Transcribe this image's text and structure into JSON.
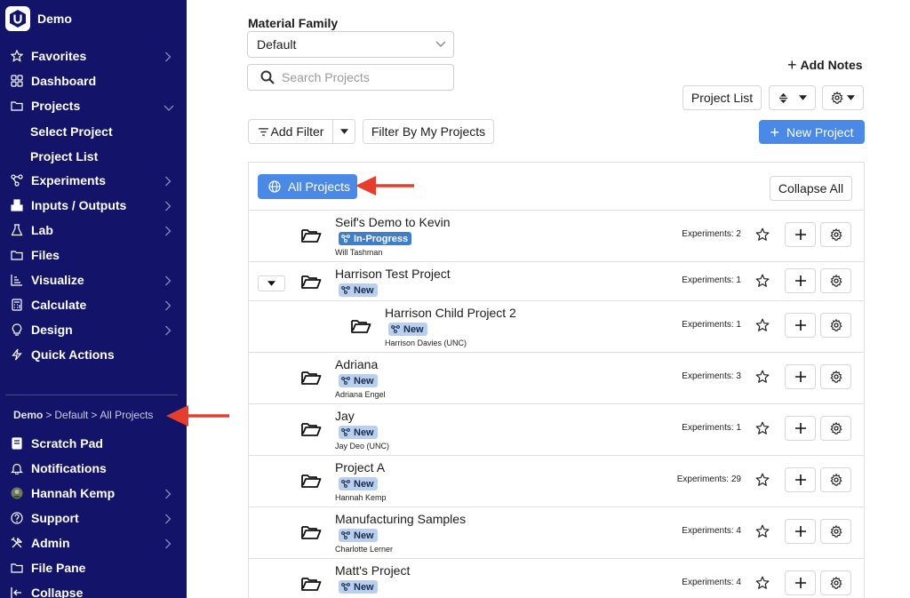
{
  "sidebar": {
    "brand": "Demo",
    "items": [
      {
        "label": "Favorites",
        "icon": "star-icon",
        "chevron": "right"
      },
      {
        "label": "Dashboard",
        "icon": "grid-icon",
        "chevron": ""
      },
      {
        "label": "Projects",
        "icon": "folder-icon",
        "chevron": "down"
      },
      {
        "label": "Experiments",
        "icon": "workflow-icon",
        "chevron": "right"
      },
      {
        "label": "Inputs / Outputs",
        "icon": "cubes-icon",
        "chevron": "right"
      },
      {
        "label": "Lab",
        "icon": "flask-icon",
        "chevron": "right"
      },
      {
        "label": "Files",
        "icon": "folder-icon",
        "chevron": ""
      },
      {
        "label": "Visualize",
        "icon": "chart-icon",
        "chevron": "right"
      },
      {
        "label": "Calculate",
        "icon": "calculator-icon",
        "chevron": "right"
      },
      {
        "label": "Design",
        "icon": "bulb-icon",
        "chevron": "right"
      },
      {
        "label": "Quick Actions",
        "icon": "bolt-icon",
        "chevron": ""
      }
    ],
    "project_sub_items": [
      "Select Project",
      "Project List"
    ],
    "breadcrumb": {
      "root": "Demo",
      "middle": "Default",
      "leaf": "All Projects"
    },
    "bottom_items": [
      {
        "label": "Scratch Pad",
        "icon": "notebook-icon",
        "chevron": ""
      },
      {
        "label": "Notifications",
        "icon": "bell-icon",
        "chevron": ""
      },
      {
        "label": "Hannah Kemp",
        "icon": "avatar-icon",
        "chevron": "right"
      },
      {
        "label": "Support",
        "icon": "help-icon",
        "chevron": "right"
      },
      {
        "label": "Admin",
        "icon": "tools-icon",
        "chevron": "right"
      },
      {
        "label": "File Pane",
        "icon": "folder-icon",
        "chevron": ""
      },
      {
        "label": "Collapse",
        "icon": "collapse-icon",
        "chevron": ""
      }
    ]
  },
  "main": {
    "material_family_label": "Material Family",
    "material_family_value": "Default",
    "search_placeholder": "Search Projects",
    "add_notes_label": "Add Notes",
    "project_list_button": "Project List",
    "add_filter_label": "Add Filter",
    "filter_by_my_projects": "Filter By My Projects",
    "new_project_label": "New Project",
    "all_projects_label": "All Projects",
    "collapse_all_label": "Collapse All"
  },
  "projects": [
    {
      "title": "Seif's Demo to Kevin",
      "status": "In-Progress",
      "owner": "Will Tashman",
      "experiments": "Experiments: 2",
      "indent": 0,
      "expandable": false
    },
    {
      "title": "Harrison Test Project",
      "status": "New",
      "owner": "",
      "experiments": "Experiments: 1",
      "indent": 0,
      "expandable": true
    },
    {
      "title": "Harrison Child Project 2",
      "status": "New",
      "owner": "Harrison Davies (UNC)",
      "experiments": "Experiments: 1",
      "indent": 1,
      "expandable": false
    },
    {
      "title": "Adriana",
      "status": "New",
      "owner": "Adriana Engel",
      "experiments": "Experiments: 3",
      "indent": 0,
      "expandable": false
    },
    {
      "title": "Jay",
      "status": "New",
      "owner": "Jay Deo (UNC)",
      "experiments": "Experiments: 1",
      "indent": 0,
      "expandable": false
    },
    {
      "title": "Project A",
      "status": "New",
      "owner": "Hannah Kemp",
      "experiments": "Experiments: 29",
      "indent": 0,
      "expandable": false
    },
    {
      "title": "Manufacturing Samples",
      "status": "New",
      "owner": "Charlotte Lerner",
      "experiments": "Experiments: 4",
      "indent": 0,
      "expandable": false
    },
    {
      "title": "Matt's Project",
      "status": "New",
      "owner": "",
      "experiments": "Experiments: 4",
      "indent": 0,
      "expandable": false
    }
  ],
  "colors": {
    "sidebar_bg": "#13136a",
    "primary": "#4a8ae6",
    "badge_new": "#b8cff0",
    "badge_in_progress": "#3e7ecb",
    "annotation_arrow": "#e53d2e"
  }
}
